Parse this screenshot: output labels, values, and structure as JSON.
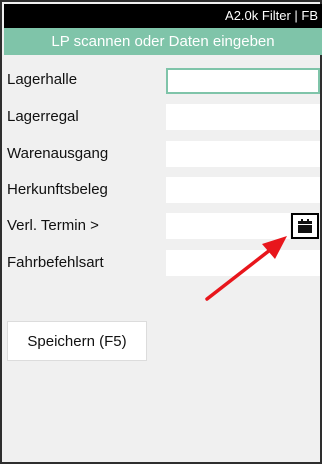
{
  "topbar": {
    "title": "A2.0k Filter | FB"
  },
  "header": {
    "text": "LP scannen oder Daten eingeben"
  },
  "form": {
    "rows": [
      {
        "label": "Lagerhalle",
        "value": ""
      },
      {
        "label": "Lagerregal",
        "value": ""
      },
      {
        "label": "Warenausgang",
        "value": ""
      },
      {
        "label": "Herkunftsbeleg",
        "value": ""
      },
      {
        "label": "Verl. Termin >",
        "value": ""
      },
      {
        "label": "Fahrbefehlsart",
        "value": ""
      }
    ]
  },
  "calendar_button": {
    "icon": "calendar-icon"
  },
  "save_button": {
    "label": "Speichern (F5)"
  },
  "colors": {
    "accent": "#7fc4a9",
    "topbar_bg": "#000000",
    "page_bg": "#f0f0f0",
    "annotation_arrow": "#e8161c"
  }
}
